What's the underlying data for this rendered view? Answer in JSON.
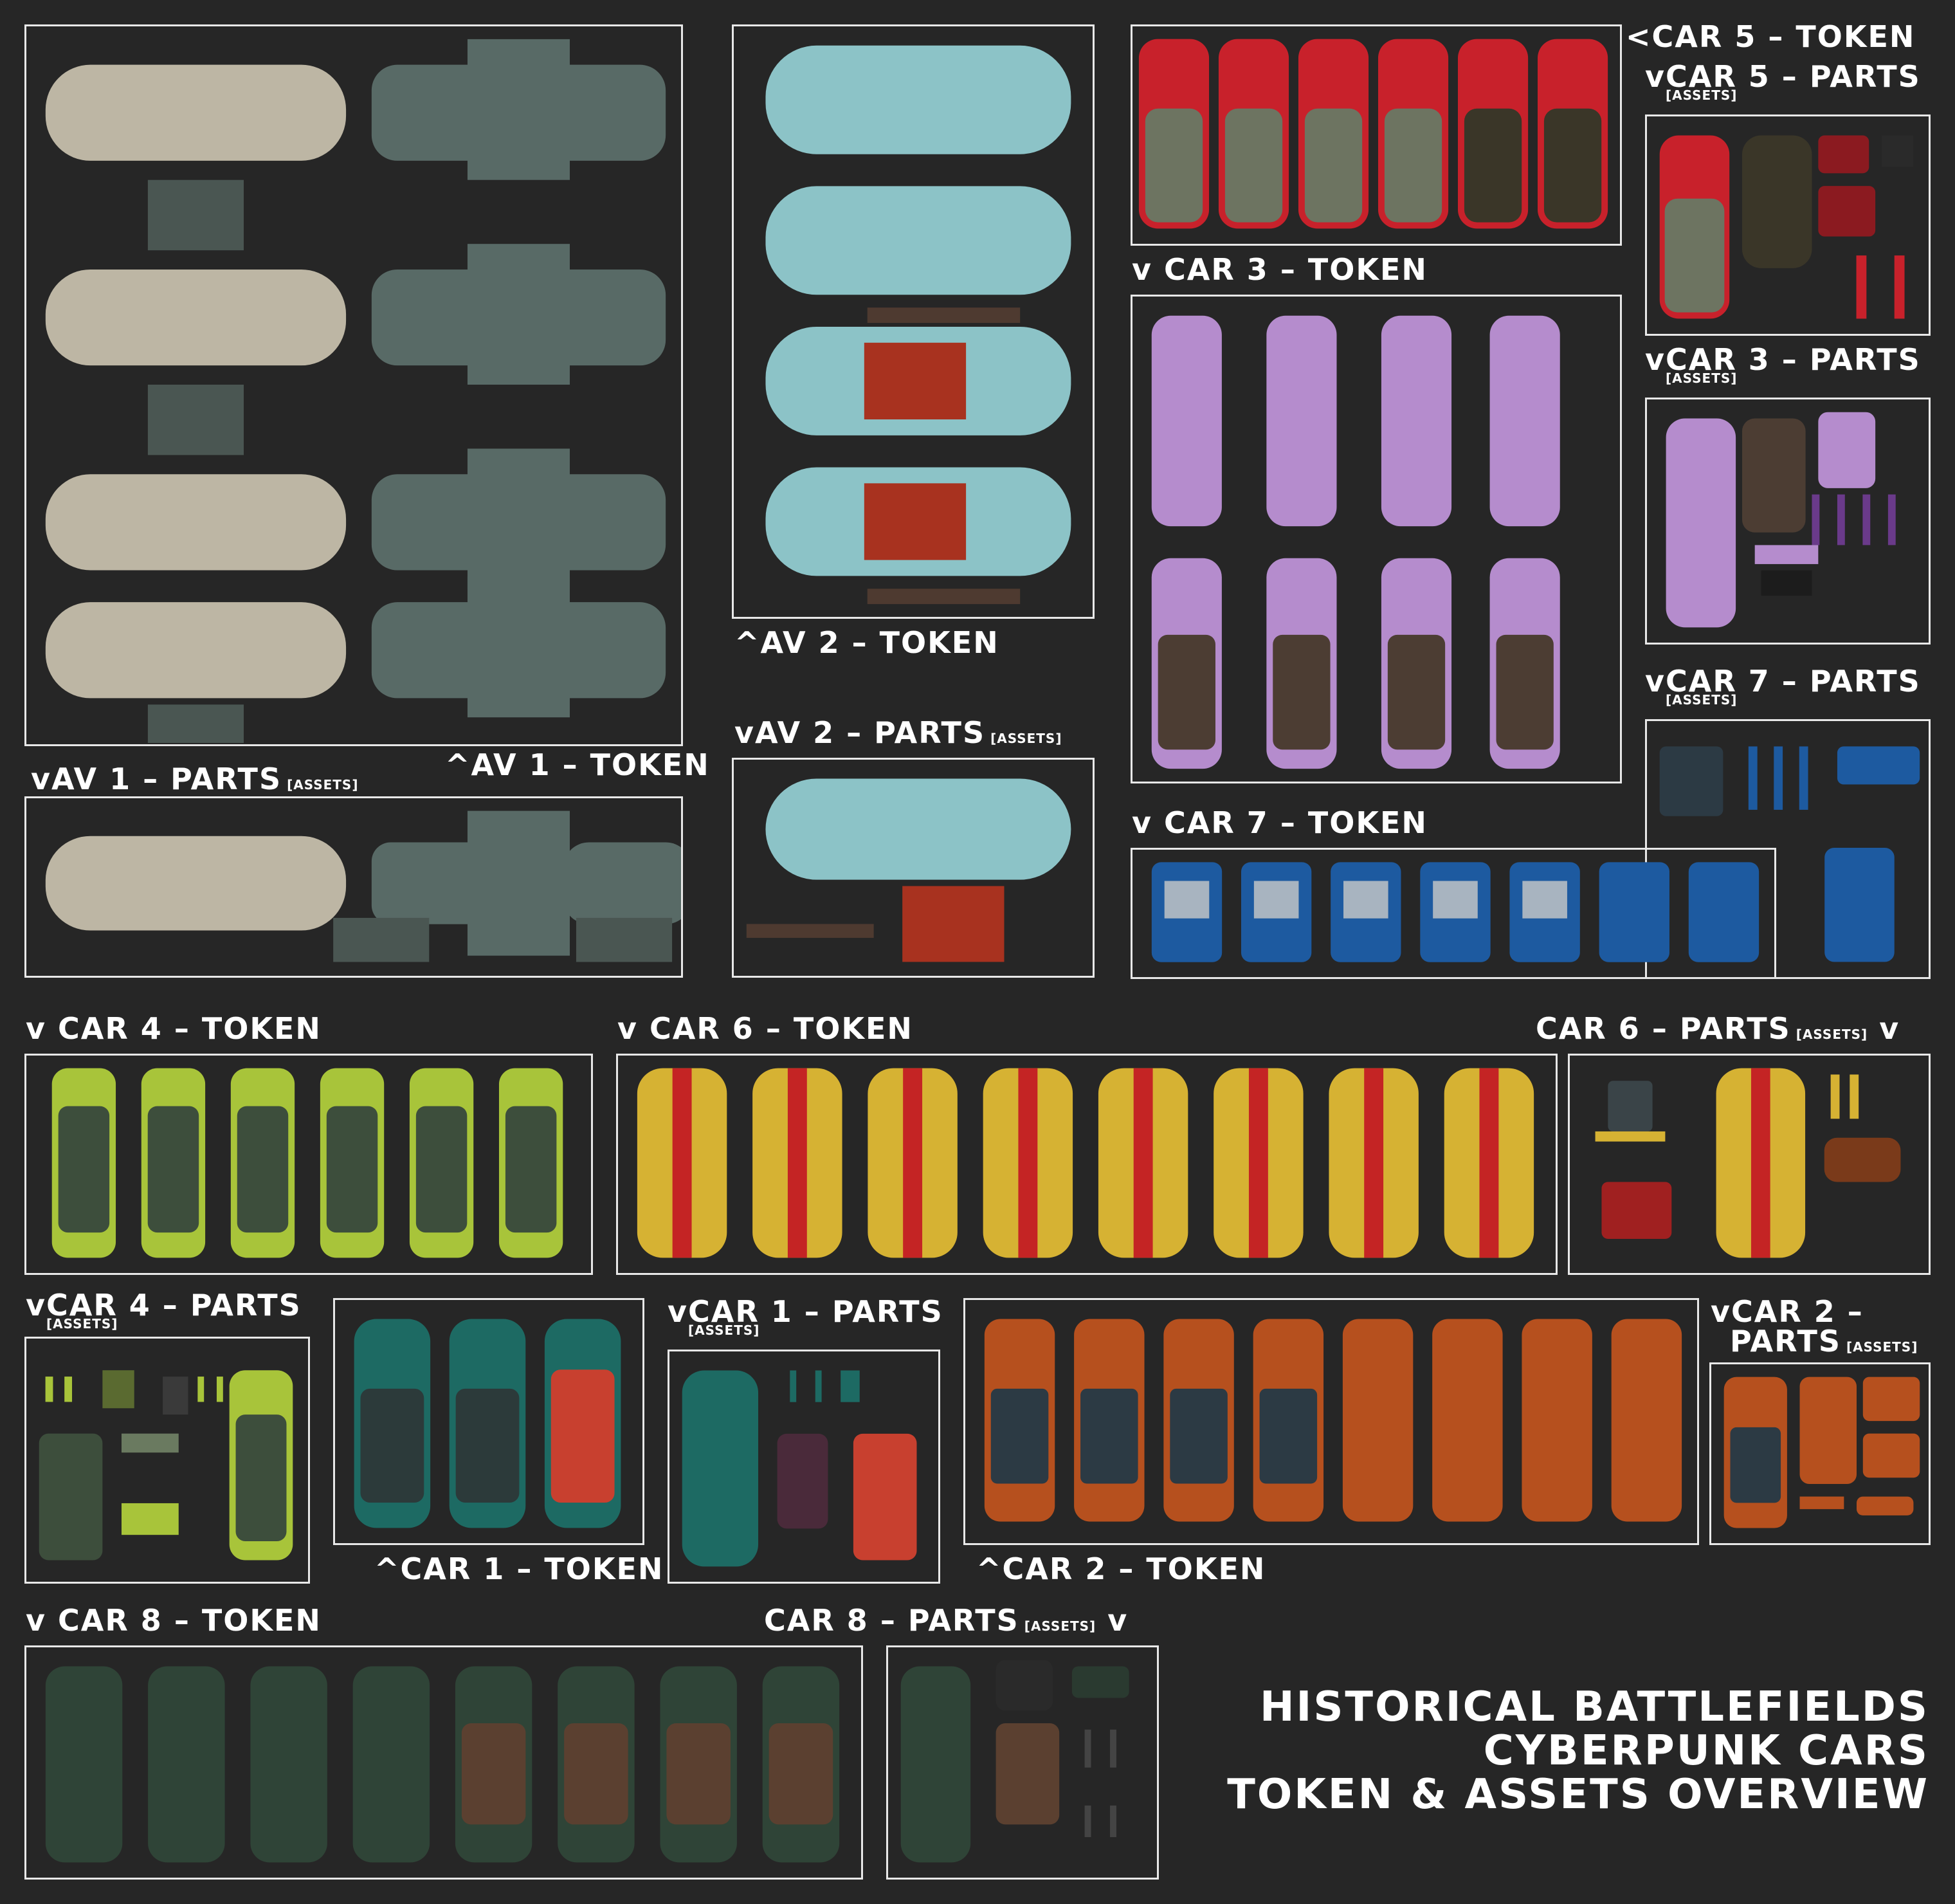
{
  "labels": {
    "car5_token": "<CAR 5 – TOKEN",
    "car5_parts": "vCAR 5 – PARTS",
    "car3_token": "v CAR 3 – TOKEN",
    "car3_parts": "vCAR 3 – PARTS",
    "car7_parts": "vCAR 7 – PARTS",
    "car7_token": "v CAR 7 – TOKEN",
    "av2_token": "^AV 2 – TOKEN",
    "av2_parts": "vAV 2 – PARTS",
    "av1_token": "^AV 1 – TOKEN",
    "av1_parts": "vAV 1 – PARTS",
    "car4_token": "v CAR 4 – TOKEN",
    "car6_token": "v CAR 6 – TOKEN",
    "car6_parts": "CAR 6 – PARTS",
    "car6_parts_suffix": "v",
    "car4_parts": "vCAR 4 – PARTS",
    "car1_parts": "vCAR 1 – PARTS",
    "car1_token": "^CAR 1 – TOKEN",
    "car2_token": "^CAR 2 – TOKEN",
    "car2_parts_line1": "vCAR 2 –",
    "car2_parts_line2": "PARTS",
    "car8_token": "v CAR 8 – TOKEN",
    "car8_parts": "CAR 8 – PARTS",
    "car8_parts_suffix": "v",
    "assets_tag": "[ASSETS]"
  },
  "title": {
    "line1": "HISTORICAL BATTLEFIELDS",
    "line2": "CYBERPUNK CARS",
    "line3": "TOKEN & ASSETS OVERVIEW"
  },
  "vehicle_colors": {
    "av1": "#bdb6a4",
    "av1_deck": "#586a66",
    "av2": "#8cc3c7",
    "av2_interior": "#a8321f",
    "car5": "#c8212b",
    "car5_interior": "#6d7461",
    "car3": "#b58ccd",
    "car3_interior": "#4c3d33",
    "car7": "#1d5aa0",
    "car4": "#a8c43a",
    "car4_interior": "#3d4e3c",
    "car6": "#d6b233",
    "car6_stripe": "#c42424",
    "car1": "#1d6a63",
    "car1_interior": "#c8402f",
    "car2": "#b6501e",
    "car2_interior": "#2c3a44",
    "car8": "#2f4437",
    "car8_interior": "#5b4030"
  }
}
